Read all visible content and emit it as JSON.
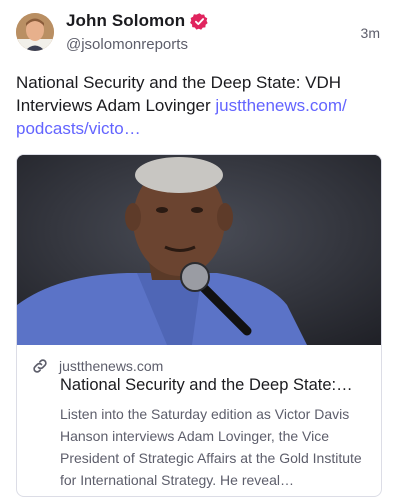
{
  "author": {
    "display_name": "John Solomon",
    "handle": "@jsolomonreports",
    "verified_badge_icon": "verified-badge-icon",
    "verified_color": "#e0245e",
    "avatar_icon": "avatar"
  },
  "post": {
    "timestamp": "3m",
    "text": "National Security and the Deep State: VDH Interviews Adam Lovinger ",
    "link_text": "justthenews.com/​podcasts/victo…",
    "link_color": "#6364ff"
  },
  "card": {
    "link_icon": "link-icon",
    "domain": "justthenews.com",
    "title": "National Security and the Deep State:…",
    "description": "Listen into the Saturday edition as Victor Davis Hanson interviews Adam Lovinger, the Vice President of Strategic Affairs at the Gold Institute for International Strategy. He reveal…"
  }
}
